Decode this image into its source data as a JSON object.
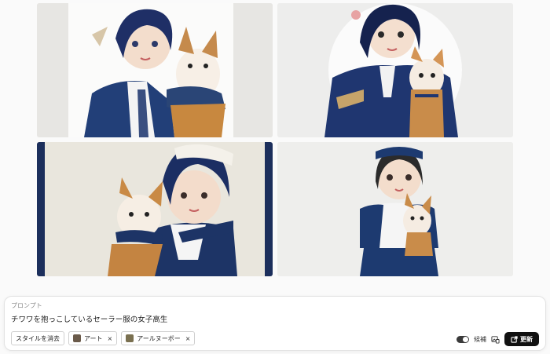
{
  "images": [
    {
      "alt": "",
      "accent": "#1f3a6e"
    },
    {
      "alt": "",
      "accent": "#1d3570"
    },
    {
      "alt": "",
      "accent": "#1b3264"
    },
    {
      "alt": "",
      "accent": "#1d3a70"
    }
  ],
  "prompt": {
    "label": "プロンプト",
    "value": "チワワを抱っこしているセーラー服の女子高生"
  },
  "chips": {
    "clear_style": "スタイルを消去",
    "styles": [
      {
        "label": "アート",
        "remove": "×",
        "thumb_color": "#6a5a4a"
      },
      {
        "label": "アールヌーボー",
        "remove": "×",
        "thumb_color": "#7a7050"
      }
    ]
  },
  "controls": {
    "toggle_label": "候補",
    "update_label": "更新"
  },
  "colors": {
    "navy": "#1d3468",
    "button_bg": "#111111"
  }
}
